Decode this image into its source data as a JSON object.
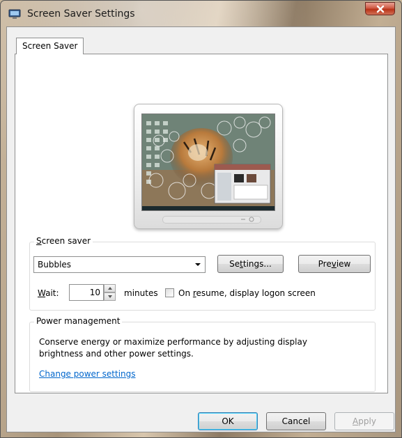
{
  "window": {
    "title": "Screen Saver Settings",
    "close_label": "x"
  },
  "tab": {
    "label": "Screen Saver"
  },
  "screen_saver": {
    "group_label_prefix": "",
    "group_label_accel": "S",
    "group_label_rest": "creen saver",
    "selected": "Bubbles",
    "settings_prefix": "Se",
    "settings_accel": "t",
    "settings_rest": "tings...",
    "preview_prefix": "Pre",
    "preview_accel": "v",
    "preview_rest": "iew",
    "wait_accel": "W",
    "wait_rest": "ait:",
    "wait_value": "10",
    "minutes_label": "minutes",
    "resume_prefix": "On ",
    "resume_accel": "r",
    "resume_rest": "esume, display logon screen",
    "resume_checked": false
  },
  "power": {
    "group_label": "Power management",
    "description": "Conserve energy or maximize performance by adjusting display brightness and other power settings.",
    "link_label": "Change power settings"
  },
  "buttons": {
    "ok": "OK",
    "cancel": "Cancel",
    "apply_accel": "A",
    "apply_rest": "pply"
  },
  "colors": {
    "link": "#0066cc",
    "close_button": "#c8452c",
    "dialog_bg": "#f0f0f0"
  }
}
